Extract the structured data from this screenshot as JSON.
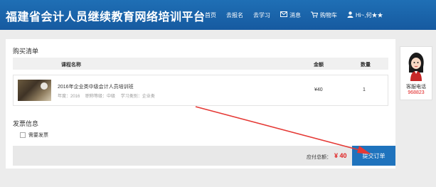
{
  "header": {
    "site_title": "福建省会计人员继续教育网络培训平台",
    "nav": [
      {
        "label": "首页",
        "icon": ""
      },
      {
        "label": "去报名",
        "icon": ""
      },
      {
        "label": "去学习",
        "icon": ""
      },
      {
        "label": "消息",
        "icon": "mail-icon"
      },
      {
        "label": "购物车",
        "icon": "cart-icon"
      },
      {
        "label": "Hi~,何★★",
        "icon": "user-icon"
      }
    ]
  },
  "order": {
    "section_title": "购买清单",
    "columns": {
      "course": "课程名称",
      "amount": "金额",
      "qty": "数量"
    },
    "item": {
      "name": "2016年企业类中级会计人员培训班",
      "year": "年度：2016",
      "level": "职称等级：中级",
      "category": "学习类别：企业类",
      "amount": "¥40",
      "qty": "1"
    },
    "invoice_title": "发票信息",
    "invoice_checkbox": "需要发票",
    "total_label": "应付总额：",
    "total_value": "¥ 40",
    "submit_label": "提交订单"
  },
  "side": {
    "label": "客服电话",
    "phone": "968823"
  },
  "colors": {
    "header": "#1565ab",
    "accent": "#1f73bd",
    "price": "#e02020",
    "annotation_arrow": "#e53935"
  }
}
